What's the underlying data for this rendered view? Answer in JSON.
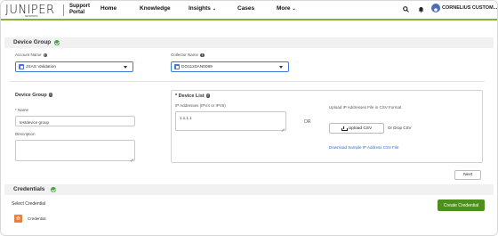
{
  "header": {
    "logo": "JUNIPER",
    "logo_sub": "NETWORKS",
    "portal_line1": "Support",
    "portal_line2": "Portal",
    "nav": [
      {
        "label": "Home",
        "has_dropdown": false
      },
      {
        "label": "Knowledge",
        "has_dropdown": false
      },
      {
        "label": "Insights",
        "has_dropdown": true
      },
      {
        "label": "Cases",
        "has_dropdown": false
      },
      {
        "label": "More",
        "has_dropdown": true
      }
    ],
    "user_name": "CORNELIUS CUSTOM...",
    "icons": {
      "search": "search-icon",
      "bell": "bell-icon",
      "user": "user-avatar-icon"
    },
    "accent_color": "#84b135"
  },
  "device_group_section": {
    "title": "Device Group",
    "account_label": "Account Name",
    "account_value": "JSAS Validation",
    "collector_label": "Collector Name",
    "collector_value": "DO1120AN0089"
  },
  "device_group_form": {
    "title": "Device Group",
    "name_label": "* Name",
    "name_value": "testdevice group",
    "description_label": "Description",
    "description_value": ""
  },
  "device_list": {
    "title": "* Device List",
    "ip_label": "IP Addresses (IPV4 or IPV6)",
    "ip_value": "1.1.1.1",
    "or_text": "OR",
    "upload_label": "Upload IP Addresses File in CSV Format",
    "upload_button": "Upload CSV",
    "drop_text": "Or Drop CSV",
    "download_link": "Download Sample IP Address CSV File"
  },
  "next_button": "Next",
  "credentials_section": {
    "title": "Credentials",
    "select_label": "Select Credential",
    "create_button": "Create Credential",
    "item_label": "Credential",
    "create_color": "#4f8f1e"
  }
}
